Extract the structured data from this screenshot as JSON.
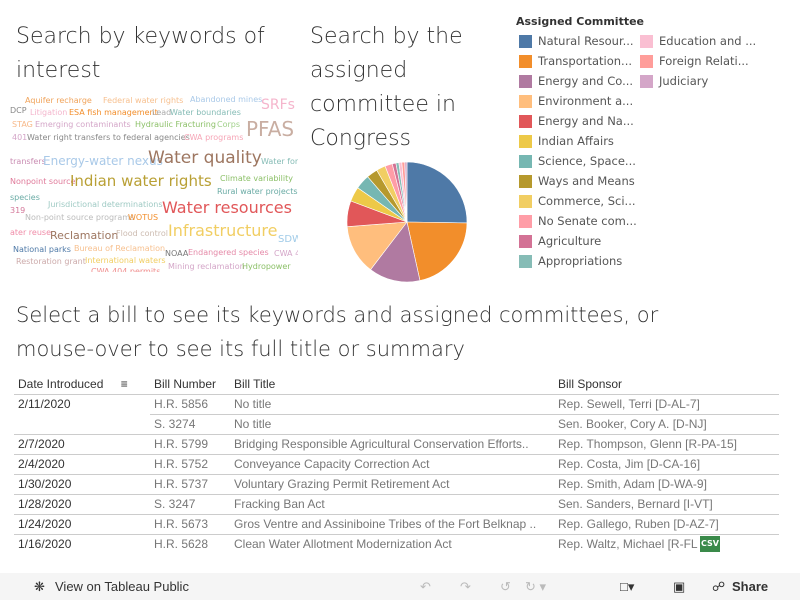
{
  "headings": {
    "keywords": [
      "Search by keywords of",
      "interest"
    ],
    "committee": [
      "Search by the",
      "assigned",
      "committee in",
      "Congress"
    ],
    "bills": [
      "Select a bill to see its keywords and assigned committees, or",
      "mouse-over to see its full title or summary"
    ]
  },
  "wordcloud": {
    "words": [
      {
        "text": "Aquifer recharge",
        "color": "#f0a35a"
      },
      {
        "text": "Federal water rights",
        "color": "#f7c08f"
      },
      {
        "text": "Abandoned mines",
        "color": "#a9c9e8"
      },
      {
        "text": "SRFs",
        "color": "#f5b5cc"
      },
      {
        "text": "DCP",
        "color": "#888"
      },
      {
        "text": "Litigation",
        "color": "#f4b6cd"
      },
      {
        "text": "ESA fish management",
        "color": "#f28e2b"
      },
      {
        "text": "Lead",
        "color": "#aaa"
      },
      {
        "text": "Water boundaries",
        "color": "#86bcb6"
      },
      {
        "text": "STAG",
        "color": "#f7b98a"
      },
      {
        "text": "Emerging contaminants",
        "color": "#d4a6c8"
      },
      {
        "text": "Hydraulic Fracturing",
        "color": "#8cc068"
      },
      {
        "text": "Corps",
        "color": "#a0d08a"
      },
      {
        "text": "PFAS",
        "color": "#c9aea2"
      },
      {
        "text": "401",
        "color": "#d4a6c8"
      },
      {
        "text": "Water right transfers to federal agencies",
        "color": "#888"
      },
      {
        "text": "CWA programs",
        "color": "#f6a6b7"
      },
      {
        "text": "transfers",
        "color": "#c98cb2"
      },
      {
        "text": "Energy-water nexus",
        "color": "#a9c9e8"
      },
      {
        "text": "Water quality",
        "color": "#9d7660"
      },
      {
        "text": "Water for",
        "color": "#86bcb6"
      },
      {
        "text": "Nonpoint source",
        "color": "#e07a9a"
      },
      {
        "text": "Indian water rights",
        "color": "#b9a035"
      },
      {
        "text": "Climate variability",
        "color": "#8cc068"
      },
      {
        "text": "Rural water projects",
        "color": "#6aaba5"
      },
      {
        "text": "species",
        "color": "#6aaba5"
      },
      {
        "text": "Jurisdictional determinations",
        "color": "#9fcac4"
      },
      {
        "text": "319",
        "color": "#d4789a"
      },
      {
        "text": "Non-point source programs",
        "color": "#bbb"
      },
      {
        "text": "WOTUS",
        "color": "#f28e2b"
      },
      {
        "text": "Water resources",
        "color": "#e15759"
      },
      {
        "text": "ater reuse",
        "color": "#f08ca8"
      },
      {
        "text": "Reclamation",
        "color": "#9d7660"
      },
      {
        "text": "Flood control",
        "color": "#ccbbb0"
      },
      {
        "text": "Infrastructure",
        "color": "#f1ce63"
      },
      {
        "text": "SDW",
        "color": "#a0cbe8"
      },
      {
        "text": "National parks",
        "color": "#4e79a7"
      },
      {
        "text": "Bureau of Reclamation",
        "color": "#f7c08f"
      },
      {
        "text": "NOAA",
        "color": "#777"
      },
      {
        "text": "Endangered species",
        "color": "#e58aa8"
      },
      {
        "text": "CWA 4",
        "color": "#d4a6c8"
      },
      {
        "text": "Restoration grant",
        "color": "#caa"
      },
      {
        "text": "International waters",
        "color": "#f1ce63"
      },
      {
        "text": "Mining reclamation",
        "color": "#d4a6c8"
      },
      {
        "text": "Hydropower",
        "color": "#8cc068"
      },
      {
        "text": "CWA 404 permits",
        "color": "#f08c8c"
      }
    ]
  },
  "legend": {
    "title": "Assigned Committee",
    "items": [
      {
        "label": "Natural Resour...",
        "color": "#4e79a7"
      },
      {
        "label": "Transportation...",
        "color": "#f28e2b"
      },
      {
        "label": "Energy and Co...",
        "color": "#b07aa1"
      },
      {
        "label": "Environment a...",
        "color": "#ffbe7d"
      },
      {
        "label": "Energy and Na...",
        "color": "#e15759"
      },
      {
        "label": "Indian Affairs",
        "color": "#edc948"
      },
      {
        "label": "Science, Space...",
        "color": "#76b7b2"
      },
      {
        "label": "Ways and Means",
        "color": "#b6992d"
      },
      {
        "label": "Commerce, Sci...",
        "color": "#f1ce63"
      },
      {
        "label": "No Senate com...",
        "color": "#ff9da7"
      },
      {
        "label": "Agriculture",
        "color": "#d37295"
      },
      {
        "label": "Appropriations",
        "color": "#86bcb6"
      },
      {
        "label": "Education and ...",
        "color": "#fabfd2"
      },
      {
        "label": "Foreign Relati...",
        "color": "#ff9d9a"
      },
      {
        "label": "Judiciary",
        "color": "#d4a6c8"
      }
    ]
  },
  "chart_data": {
    "type": "pie",
    "title": "",
    "categories": [
      "Natural Resources",
      "Transportation",
      "Energy and Commerce",
      "Environment",
      "Energy and Natural Resources",
      "Indian Affairs",
      "Science, Space",
      "Ways and Means",
      "Commerce, Science",
      "No Senate committee",
      "Agriculture",
      "Appropriations",
      "Education",
      "Foreign Relations",
      "Judiciary"
    ],
    "values": [
      25.5,
      21.5,
      14,
      13.5,
      7,
      4,
      4,
      3,
      2.5,
      2,
      1,
      0.8,
      0.8,
      0.8,
      0.6
    ],
    "legend": "right"
  },
  "table": {
    "headers": [
      "Date Introduced",
      "Bill Number",
      "Bill Title",
      "Bill Sponsor"
    ],
    "rows": [
      {
        "date": "2/11/2020",
        "number": "H.R. 5856",
        "title": "No title",
        "sponsor": "Rep. Sewell, Terri [D-AL-7]"
      },
      {
        "date": "",
        "number": "S. 3274",
        "title": "No title",
        "sponsor": "Sen. Booker, Cory A. [D-NJ]"
      },
      {
        "date": "2/7/2020",
        "number": "H.R. 5799",
        "title": "Bridging Responsible Agricultural Conservation Efforts..",
        "sponsor": "Rep. Thompson, Glenn [R-PA-15]"
      },
      {
        "date": "2/4/2020",
        "number": "H.R. 5752",
        "title": "Conveyance Capacity Correction Act",
        "sponsor": "Rep. Costa, Jim [D-CA-16]"
      },
      {
        "date": "1/30/2020",
        "number": "H.R. 5737",
        "title": "Voluntary Grazing Permit Retirement Act",
        "sponsor": "Rep. Smith, Adam [D-WA-9]"
      },
      {
        "date": "1/28/2020",
        "number": "S. 3247",
        "title": "Fracking Ban Act",
        "sponsor": "Sen. Sanders, Bernard [I-VT]"
      },
      {
        "date": "1/24/2020",
        "number": "H.R. 5673",
        "title": "Gros Ventre and Assiniboine Tribes of the Fort Belknap ..",
        "sponsor": "Rep. Gallego, Ruben [D-AZ-7]"
      },
      {
        "date": "1/16/2020",
        "number": "H.R. 5628",
        "title": "Clean Water Allotment Modernization Act",
        "sponsor": "Rep. Waltz, Michael [R-FL"
      }
    ]
  },
  "csv_label": "CSV",
  "footer": {
    "view": "View on Tableau Public",
    "share": "Share"
  }
}
